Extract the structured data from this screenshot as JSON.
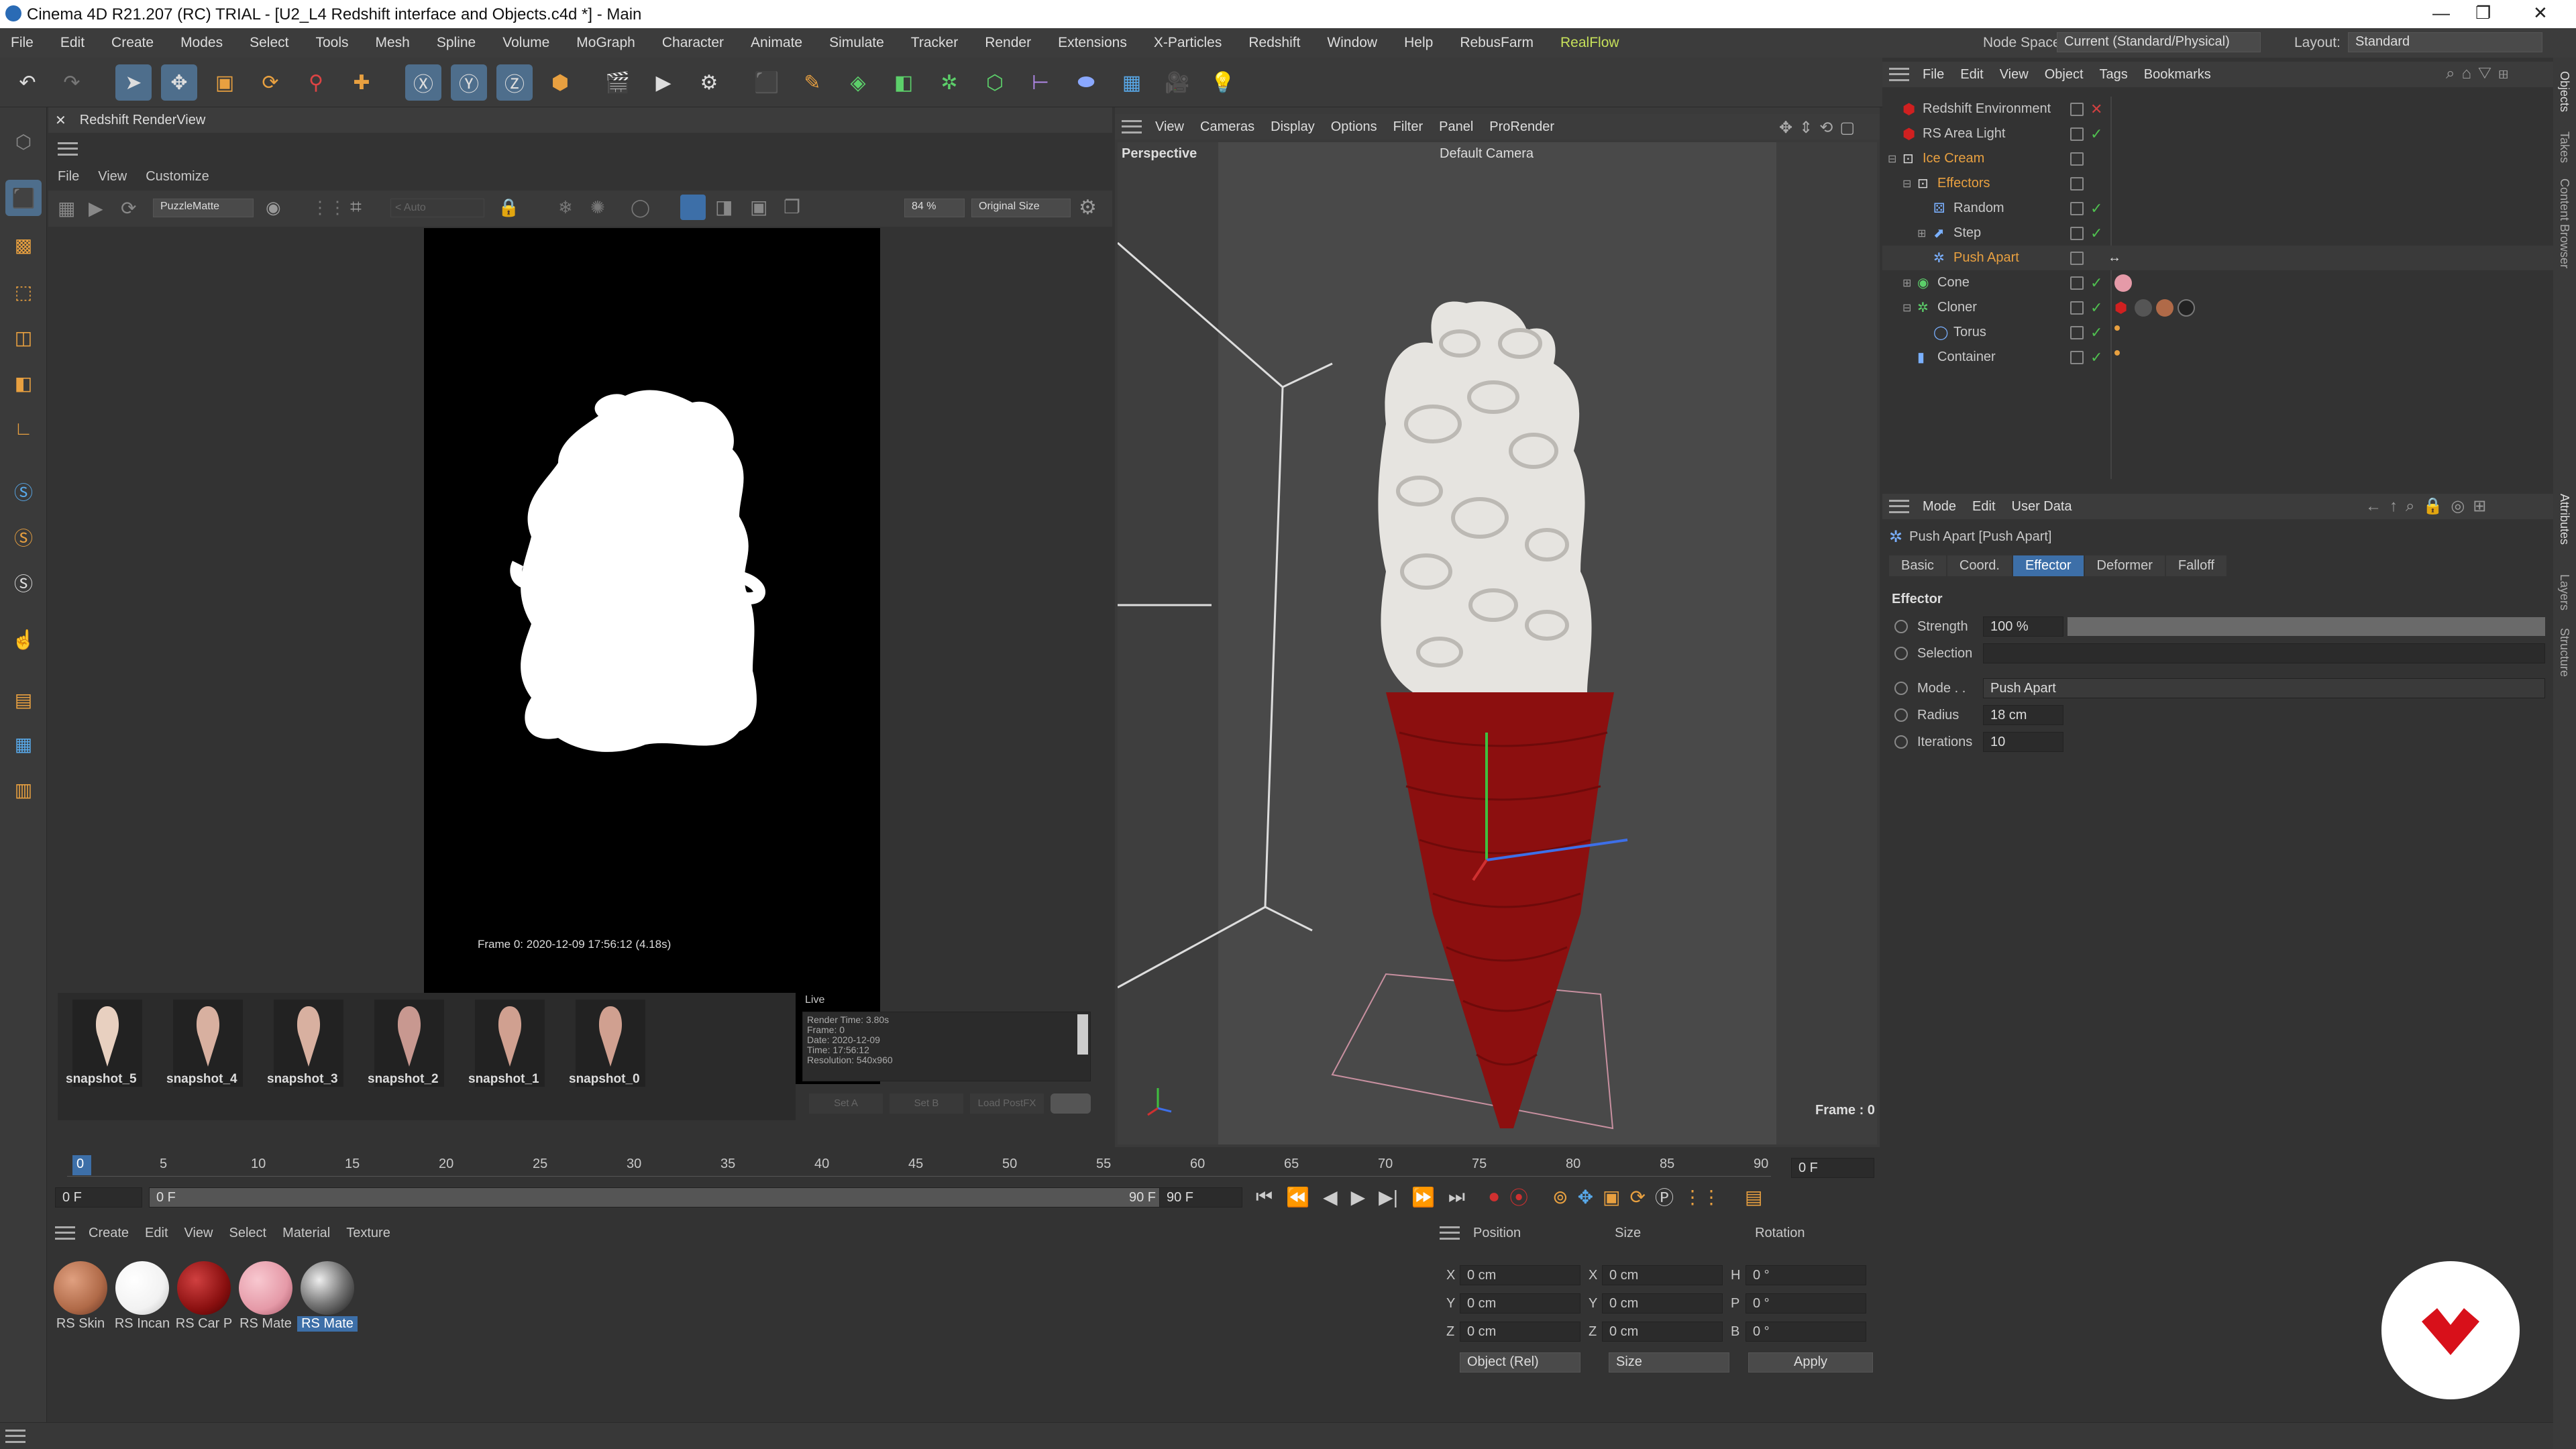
{
  "window": {
    "title": "Cinema 4D R21.207 (RC) TRIAL - [U2_L4 Redshift interface and Objects.c4d *] - Main"
  },
  "menu": {
    "items": [
      "File",
      "Edit",
      "Create",
      "Modes",
      "Select",
      "Tools",
      "Mesh",
      "Spline",
      "Volume",
      "MoGraph",
      "Character",
      "Animate",
      "Simulate",
      "Tracker",
      "Render",
      "Extensions",
      "X-Particles",
      "Redshift",
      "Window",
      "Help",
      "RebusFarm",
      "RealFlow"
    ],
    "node_space_label": "Node Space:",
    "node_space_value": "Current (Standard/Physical)",
    "layout_label": "Layout:",
    "layout_value": "Standard"
  },
  "renderview": {
    "title": "Redshift RenderView",
    "menu": [
      "File",
      "View",
      "Customize"
    ],
    "aov": "PuzzleMatte",
    "auto": "Auto",
    "zoom": "84 %",
    "size": "Original Size",
    "frame_info": "Frame 0:  2020-12-09  17:56:12  (4.18s)",
    "snapshots": [
      "snapshot_5",
      "snapshot_4",
      "snapshot_3",
      "snapshot_2",
      "snapshot_1",
      "snapshot_0"
    ],
    "live_label": "Live",
    "stats": [
      "Render Time: 3.80s",
      "Frame: 0",
      "Date: 2020-12-09",
      "Time: 17:56:12",
      "Resolution: 540x960"
    ],
    "buttons": [
      "Set A",
      "Set B",
      "Load PostFX"
    ]
  },
  "viewport": {
    "menu": [
      "View",
      "Cameras",
      "Display",
      "Options",
      "Filter",
      "Panel",
      "ProRender"
    ],
    "name": "Perspective",
    "camera": "Default Camera",
    "frame": "Frame : 0"
  },
  "object_manager": {
    "menu": [
      "File",
      "Edit",
      "View",
      "Object",
      "Tags",
      "Bookmarks"
    ],
    "objects": [
      {
        "name": "Redshift Environment",
        "indent": 0
      },
      {
        "name": "RS Area Light",
        "indent": 0
      },
      {
        "name": "Ice Cream",
        "indent": 0
      },
      {
        "name": "Effectors",
        "indent": 1
      },
      {
        "name": "Random",
        "indent": 2
      },
      {
        "name": "Step",
        "indent": 2
      },
      {
        "name": "Push Apart",
        "indent": 2
      },
      {
        "name": "Cone",
        "indent": 1
      },
      {
        "name": "Cloner",
        "indent": 1
      },
      {
        "name": "Torus",
        "indent": 2
      },
      {
        "name": "Container",
        "indent": 1
      }
    ]
  },
  "attributes": {
    "menu": [
      "Mode",
      "Edit",
      "User Data"
    ],
    "object_title": "Push Apart [Push Apart]",
    "tabs": [
      "Basic",
      "Coord.",
      "Effector",
      "Deformer",
      "Falloff"
    ],
    "active_tab": "Effector",
    "section": "Effector",
    "strength_label": "Strength",
    "strength_value": "100 %",
    "strength_fraction": 1.0,
    "selection_label": "Selection",
    "mode_label": "Mode . .",
    "mode_value": "Push Apart",
    "radius_label": "Radius",
    "radius_value": "18 cm",
    "iterations_label": "Iterations",
    "iterations_value": "10"
  },
  "side_tabs": [
    "Objects",
    "Takes",
    "Content Browser",
    "Attributes",
    "Layers",
    "Structure"
  ],
  "timeline": {
    "ticks": [
      "0",
      "5",
      "10",
      "15",
      "20",
      "25",
      "30",
      "35",
      "40",
      "45",
      "50",
      "55",
      "60",
      "65",
      "70",
      "75",
      "80",
      "85",
      "90"
    ],
    "current_frame": "0 F",
    "start": "0 F",
    "range_start": "0 F",
    "range_end": "90 F",
    "end": "90 F"
  },
  "material_manager": {
    "menu": [
      "Create",
      "Edit",
      "View",
      "Select",
      "Material",
      "Texture"
    ],
    "materials": [
      {
        "label": "RS Skin",
        "color": "#b06a48"
      },
      {
        "label": "RS Incan",
        "color": "#f2f2f2"
      },
      {
        "label": "RS Car P",
        "color": "#8a1010"
      },
      {
        "label": "RS Mate",
        "color": "#e59aa8"
      },
      {
        "label": "RS Mate",
        "color": "#777777"
      }
    ]
  },
  "coordinates": {
    "headers": [
      "Position",
      "Size",
      "Rotation"
    ],
    "rows": [
      {
        "a": "X",
        "p": "0 cm",
        "b": "X",
        "s": "0 cm",
        "c": "H",
        "r": "0 °"
      },
      {
        "a": "Y",
        "p": "0 cm",
        "b": "Y",
        "s": "0 cm",
        "c": "P",
        "r": "0 °"
      },
      {
        "a": "Z",
        "p": "0 cm",
        "b": "Z",
        "s": "0 cm",
        "c": "B",
        "r": "0 °"
      }
    ],
    "mode": "Object (Rel)",
    "size_mode": "Size",
    "apply": "Apply"
  },
  "colors": {
    "accent": "#3d6fa8",
    "selected_text": "#e8a040",
    "cone": "#8c0f0f"
  },
  "icons": [
    "undo-icon",
    "redo-icon",
    "select-icon",
    "move-icon",
    "scale-icon",
    "rotate-icon",
    "x-axis-icon",
    "y-axis-icon",
    "z-axis-icon",
    "render-icon",
    "cube-icon",
    "light-icon",
    "logo-icon"
  ]
}
